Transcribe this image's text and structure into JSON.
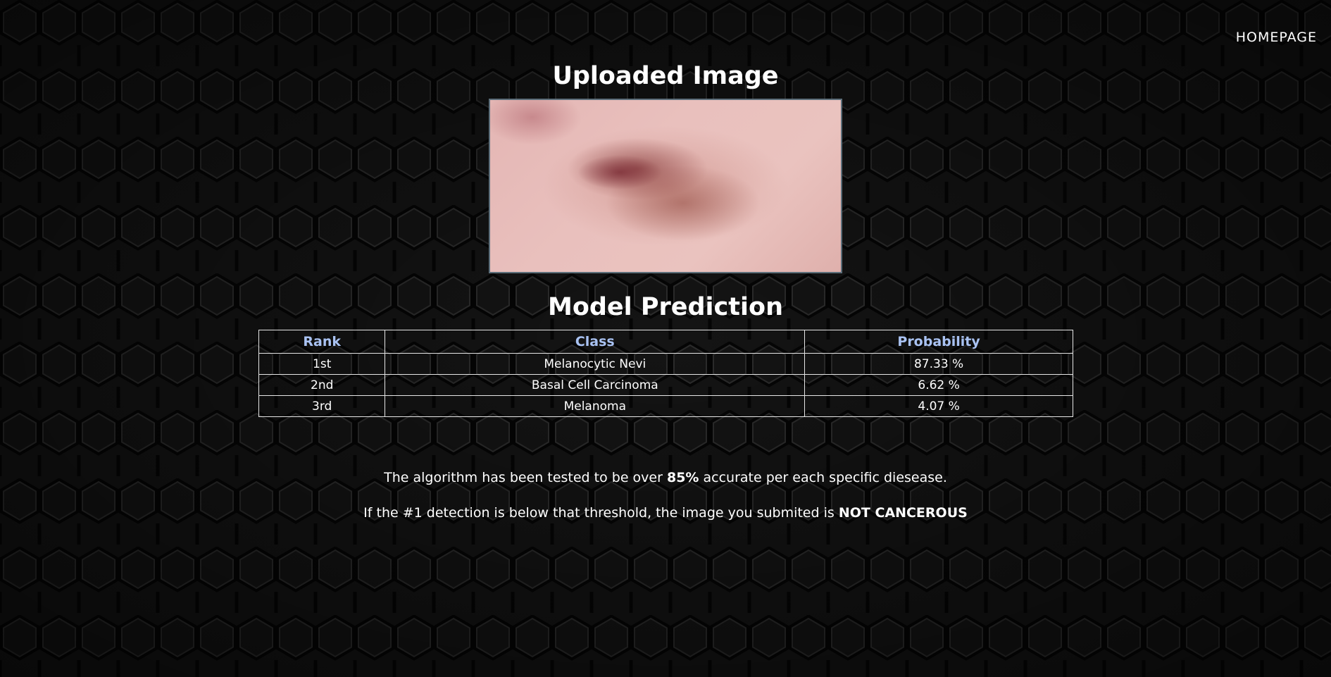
{
  "nav": {
    "homepage_label": "HOMEPAGE"
  },
  "upload": {
    "title": "Uploaded Image"
  },
  "prediction": {
    "title": "Model Prediction",
    "headers": {
      "rank": "Rank",
      "class": "Class",
      "probability": "Probability"
    },
    "rows": [
      {
        "rank": "1st",
        "class": "Melanocytic Nevi",
        "probability": "87.33 %"
      },
      {
        "rank": "2nd",
        "class": "Basal Cell Carcinoma",
        "probability": "6.62 %"
      },
      {
        "rank": "3rd",
        "class": "Melanoma",
        "probability": "4.07 %"
      }
    ]
  },
  "notes": {
    "line1_pre": "The algorithm has been tested to be over ",
    "line1_bold": "85%",
    "line1_post": " accurate per each specific diesease.",
    "line2_pre": "If the #1 detection is below that threshold, the image you submited is ",
    "line2_bold": "NOT CANCEROUS"
  },
  "colors": {
    "header_text": "#a9c2f2",
    "background": "#141414",
    "text": "#ffffff"
  }
}
